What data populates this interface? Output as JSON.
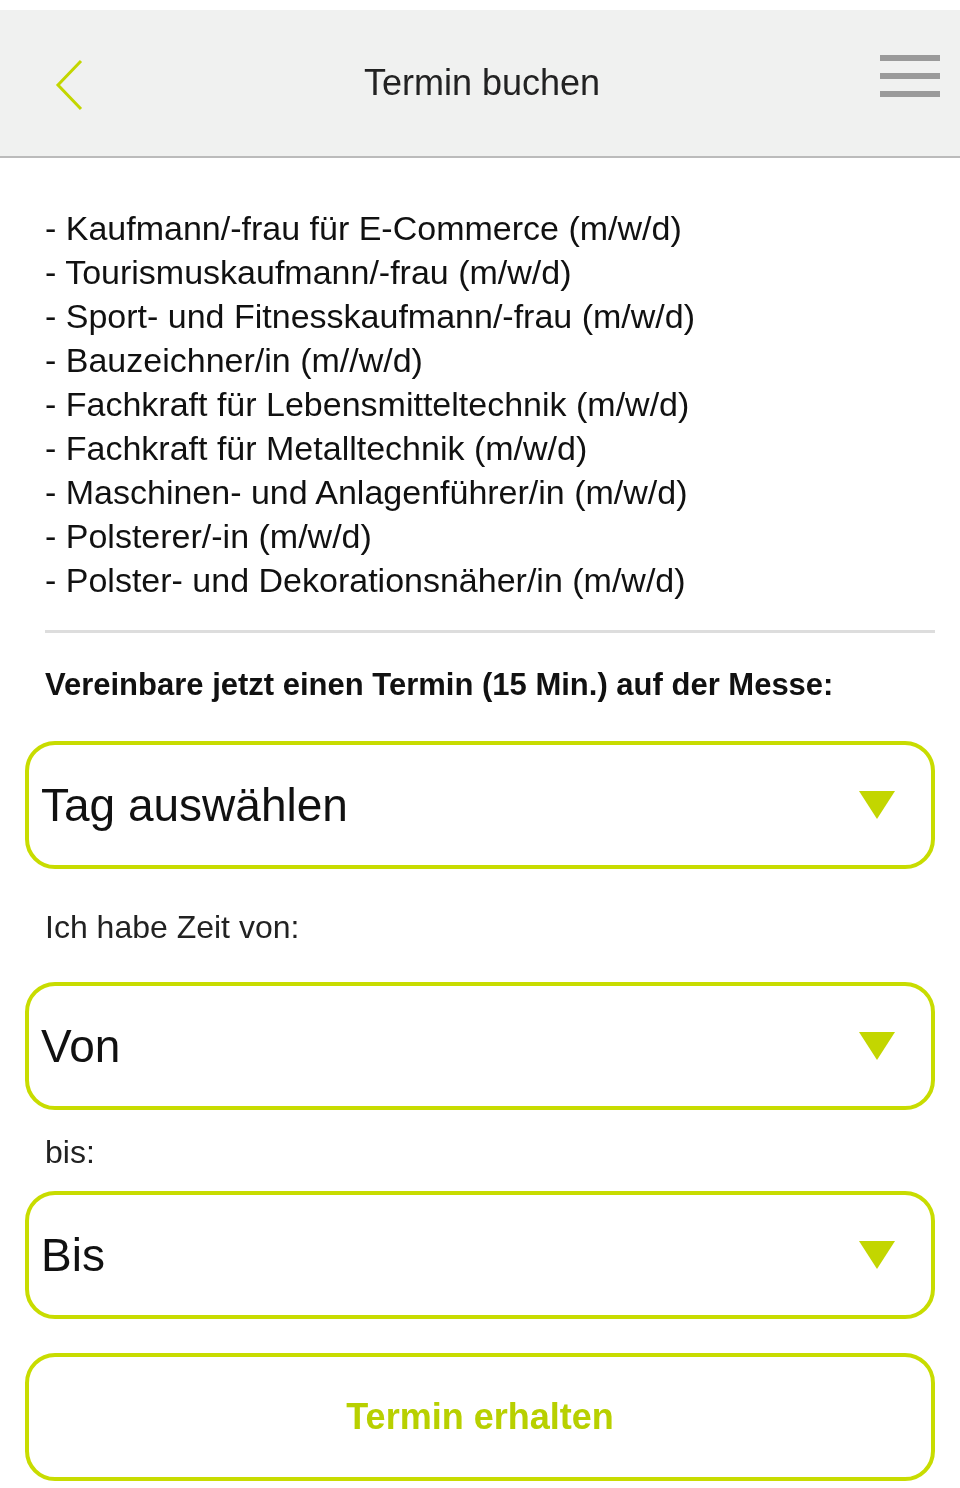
{
  "header": {
    "title": "Termin buchen"
  },
  "professions": [
    "- Kaufmann/-frau für E-Commerce (m/w/d)",
    "- Tourismuskaufmann/-frau (m/w/d)",
    "- Sport- und Fitnesskaufmann/-frau (m/w/d)",
    "- Bauzeichner/in (m//w/d)",
    "- Fachkraft für Lebensmitteltechnik (m/w/d)",
    "- Fachkraft für Metalltechnik (m/w/d)",
    "- Maschinen- und Anlagenführer/in (m/w/d)",
    "- Polsterer/-in (m/w/d)",
    "- Polster- und Dekorationsnäher/in (m/w/d)"
  ],
  "booking_heading": "Vereinbare jetzt einen Termin (15 Min.) auf der Messe:",
  "form": [
    {
      "kind": "select",
      "value": "Tag auswählen"
    },
    {
      "kind": "label",
      "text": "Ich habe Zeit von:"
    },
    {
      "kind": "select",
      "value": "Von"
    },
    {
      "kind": "label",
      "text": "bis:"
    },
    {
      "kind": "select",
      "value": "Bis"
    }
  ],
  "submit_button": "Termin erhalten"
}
